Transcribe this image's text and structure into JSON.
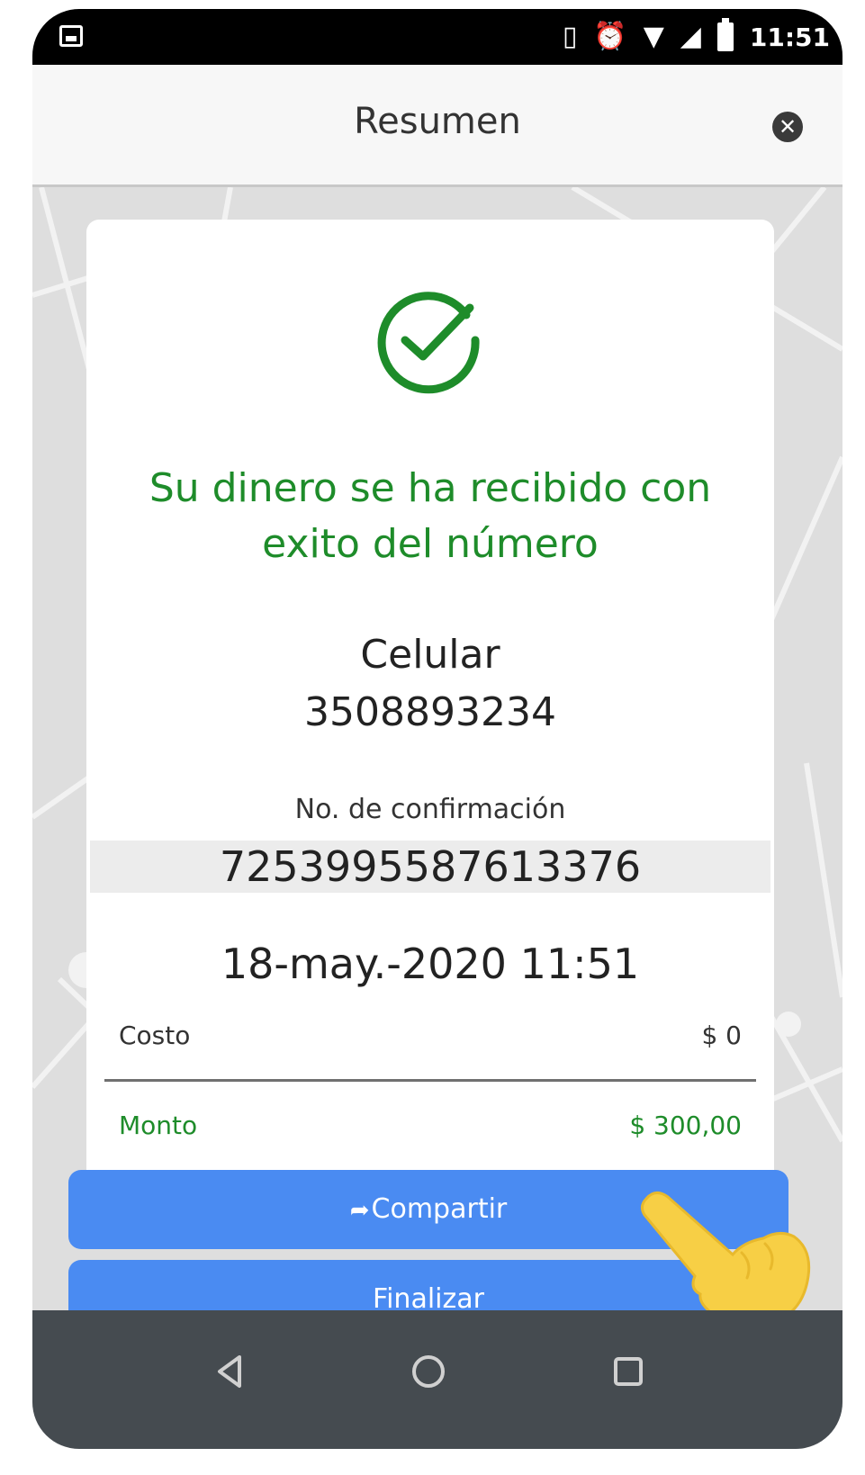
{
  "status_bar": {
    "time": "11:51",
    "icons": [
      "image-notification-icon",
      "vibrate-icon",
      "alarm-icon",
      "wifi-icon",
      "signal-icon",
      "battery-icon"
    ]
  },
  "header": {
    "title": "Resumen",
    "close_icon": "close-icon"
  },
  "receipt": {
    "status_icon": "check-circle-icon",
    "message": "Su dinero se ha recibido con exito del número",
    "type_label": "Celular",
    "phone_number": "3508893234",
    "confirmation_label": "No. de confirmación",
    "confirmation_number": "7253995587613376",
    "date": "18-may.-2020 11:51",
    "cost_label": "Costo",
    "cost_value": "$ 0",
    "amount_label": "Monto",
    "amount_value": "$ 300,00"
  },
  "buttons": {
    "share_icon": "share-icon",
    "share_label": "Compartir",
    "finish_label": "Finalizar"
  },
  "nav": {
    "icons": [
      "back-icon",
      "home-icon",
      "recents-icon"
    ]
  },
  "colors": {
    "success_green": "#1e8c2a",
    "button_blue": "#4a8bf2",
    "nav_bar": "#454b50",
    "hand_yellow": "#f7cf45"
  }
}
